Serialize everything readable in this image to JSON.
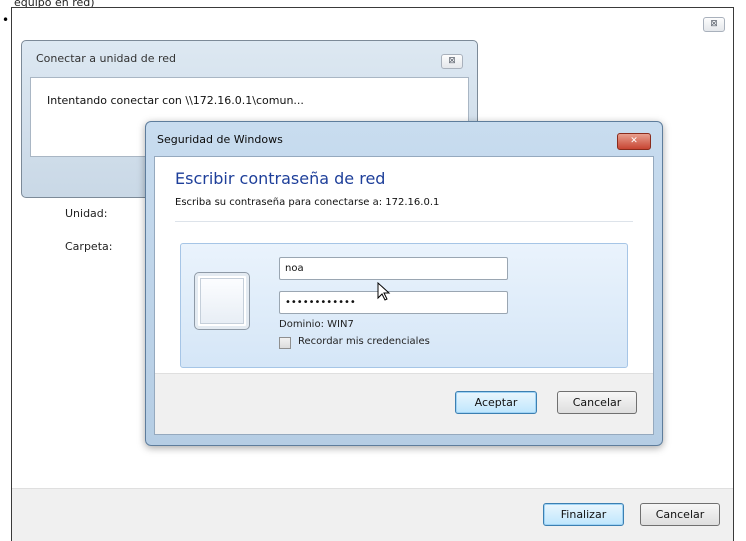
{
  "caption": {
    "top_text": "equipo en red)"
  },
  "main_window": {
    "fields": {
      "drive_label": "Unidad:",
      "folder_label": "Carpeta:"
    },
    "buttons": {
      "finish": "Finalizar",
      "cancel": "Cancelar"
    },
    "close_glyph": "⊠"
  },
  "connect_dialog": {
    "title": "Conectar a unidad de red",
    "message": "Intentando conectar con \\\\172.16.0.1\\comun...",
    "close_glyph": "⊠"
  },
  "credentials_dialog": {
    "title": "Seguridad de Windows",
    "close_glyph": "✕",
    "heading": "Escribir contraseña de red",
    "subheading": "Escriba su contraseña para conectarse a: 172.16.0.1",
    "username_value": "noa",
    "password_value": "••••••••••••",
    "domain_text": "Dominio: WIN7",
    "remember_label": "Recordar mis credenciales",
    "remember_checked": false,
    "buttons": {
      "accept": "Aceptar",
      "cancel": "Cancelar"
    }
  },
  "colors": {
    "heading_blue": "#1e3f9a",
    "close_red": "#c74532",
    "default_button_blue": "#bee6fd"
  },
  "icons": [
    "close-icon",
    "user-picture-icon",
    "mouse-cursor-icon"
  ]
}
